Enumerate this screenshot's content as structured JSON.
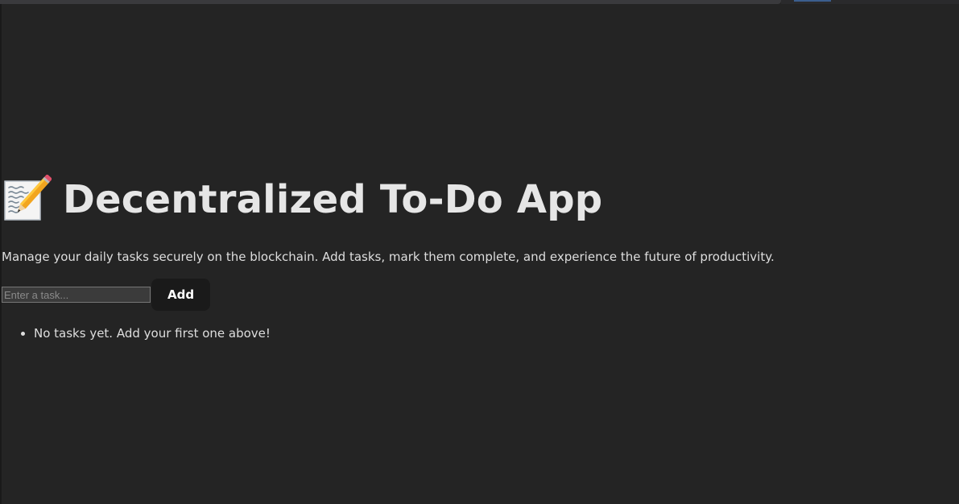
{
  "app": {
    "title": "Decentralized To-Do App",
    "title_icon": "memo-pencil-icon",
    "subtitle": "Manage your daily tasks securely on the blockchain. Add tasks, mark them complete, and experience the future of productivity."
  },
  "form": {
    "input_placeholder": "Enter a task...",
    "input_value": "",
    "add_label": "Add"
  },
  "tasks": {
    "empty_message": "No tasks yet. Add your first one above!"
  },
  "colors": {
    "background": "#242424",
    "button_background": "#1a1a1a",
    "text": "#e6e6e6"
  }
}
